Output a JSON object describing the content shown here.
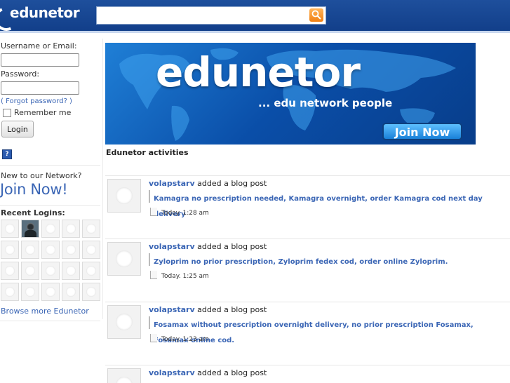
{
  "header": {
    "logo": "edunetor",
    "search_placeholder": ""
  },
  "login": {
    "username_label": "Username or Email:",
    "password_label": "Password:",
    "forgot": "( Forgot password? )",
    "remember": "Remember me",
    "login_button": "Login"
  },
  "sidebar": {
    "new_to_network": "New to our Network?",
    "join_now": "Join Now!",
    "recent_logins": "Recent Logins:",
    "browse_more": "Browse more Edunetor"
  },
  "banner": {
    "logo": "edunetor",
    "tagline": "... edu network people",
    "join_button": "Join Now"
  },
  "activities": {
    "title": "Edunetor activities",
    "posts": [
      {
        "user": "volapstarv",
        "action": "added a blog post",
        "title": "Kamagra no prescription needed, Kamagra overnight, order Kamagra cod next day delivery",
        "time": "Today. 1:28 am"
      },
      {
        "user": "volapstarv",
        "action": "added a blog post",
        "title": "Zyloprim no prior prescription, Zyloprim fedex cod, order online Zyloprim.",
        "time": "Today. 1:25 am"
      },
      {
        "user": "volapstarv",
        "action": "added a blog post",
        "title": "Fosamax without prescription overnight delivery, no prior prescription Fosamax, Fosamax online cod.",
        "time": "Today. 1:23 am"
      },
      {
        "user": "volapstarv",
        "action": "added a blog post",
        "title": "",
        "time": ""
      }
    ]
  },
  "colors": {
    "header_bg": "#1e4f9c",
    "link": "#3b66b5",
    "search_button": "#f07f12"
  },
  "icons": [
    "search-icon",
    "help-icon",
    "avatar-placeholder-icon",
    "document-icon"
  ]
}
